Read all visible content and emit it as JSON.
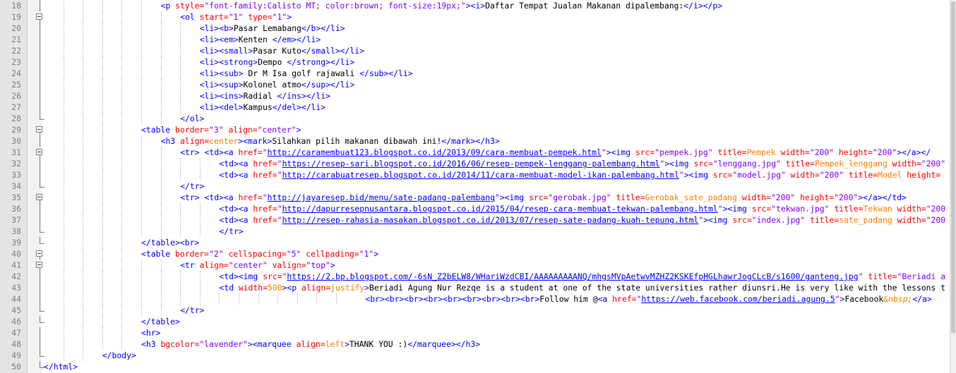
{
  "editor": {
    "lines": [
      {
        "n": "18",
        "indent": 6,
        "fold": "tick",
        "tokens": [
          [
            "tag",
            "<p "
          ],
          [
            "attr",
            "style="
          ],
          [
            "str",
            "\"font-family:Calisto MT; color:brown; font-size:19px;\""
          ],
          [
            "tag",
            ">"
          ],
          [
            "tag",
            "<i>"
          ],
          [
            "text",
            "Daftar Tempat Jualan Makanan dipalembang:"
          ],
          [
            "tag",
            "</i></p>"
          ]
        ]
      },
      {
        "n": "19",
        "indent": 7,
        "fold": "open",
        "tokens": [
          [
            "tag",
            "<ol "
          ],
          [
            "attr",
            "start="
          ],
          [
            "str",
            "\"1\" "
          ],
          [
            "attr",
            "type="
          ],
          [
            "str",
            "\"1\""
          ],
          [
            "tag",
            ">"
          ]
        ]
      },
      {
        "n": "20",
        "indent": 8,
        "fold": "tick",
        "tokens": [
          [
            "tag",
            "<li><b>"
          ],
          [
            "text",
            "Pasar Lemabang"
          ],
          [
            "tag",
            "</b></li>"
          ]
        ]
      },
      {
        "n": "21",
        "indent": 8,
        "fold": "tick",
        "tokens": [
          [
            "tag",
            "<li><em>"
          ],
          [
            "text",
            "Kenten "
          ],
          [
            "tag",
            "</em></li>"
          ]
        ]
      },
      {
        "n": "22",
        "indent": 8,
        "fold": "tick",
        "tokens": [
          [
            "tag",
            "<li><small>"
          ],
          [
            "text",
            "Pasar Kuto"
          ],
          [
            "tag",
            "</small></li>"
          ]
        ]
      },
      {
        "n": "23",
        "indent": 8,
        "fold": "tick",
        "tokens": [
          [
            "tag",
            "<li><strong>"
          ],
          [
            "text",
            "Dempo "
          ],
          [
            "tag",
            "</strong></li>"
          ]
        ]
      },
      {
        "n": "24",
        "indent": 8,
        "fold": "tick",
        "tokens": [
          [
            "tag",
            "<li><sub>"
          ],
          [
            "text",
            " Dr M Isa golf rajawali "
          ],
          [
            "tag",
            "</sub></li>"
          ]
        ]
      },
      {
        "n": "25",
        "indent": 8,
        "fold": "tick",
        "tokens": [
          [
            "tag",
            "<li><sup>"
          ],
          [
            "text",
            "Kolonel atmo"
          ],
          [
            "tag",
            "</sup></li>"
          ]
        ]
      },
      {
        "n": "26",
        "indent": 8,
        "fold": "tick",
        "tokens": [
          [
            "tag",
            "<li><ins>"
          ],
          [
            "text",
            "Radial "
          ],
          [
            "tag",
            "</ins></li>"
          ]
        ]
      },
      {
        "n": "27",
        "indent": 8,
        "fold": "tick",
        "tokens": [
          [
            "tag",
            "<li><del>"
          ],
          [
            "text",
            "Kampus"
          ],
          [
            "tag",
            "</del></li>"
          ]
        ]
      },
      {
        "n": "28",
        "indent": 7,
        "fold": "end",
        "tokens": [
          [
            "tag",
            "</ol>"
          ]
        ]
      },
      {
        "n": "29",
        "indent": 5,
        "fold": "open",
        "tokens": [
          [
            "tag",
            "<table "
          ],
          [
            "attr",
            "border="
          ],
          [
            "str",
            "\"3\" "
          ],
          [
            "attr",
            "align="
          ],
          [
            "str",
            "\"center\""
          ],
          [
            "tag",
            ">"
          ]
        ]
      },
      {
        "n": "30",
        "indent": 6,
        "fold": "tick",
        "tokens": [
          [
            "tag",
            "<h3 "
          ],
          [
            "attr",
            "align="
          ],
          [
            "unq",
            "center"
          ],
          [
            "tag",
            "><mark>"
          ],
          [
            "text",
            "Silahkan pilih makanan dibawah ini!"
          ],
          [
            "tag",
            "</mark></h3>"
          ]
        ]
      },
      {
        "n": "31",
        "indent": 7,
        "fold": "open",
        "tokens": [
          [
            "tag",
            "<tr> <td><a "
          ],
          [
            "attr",
            "href="
          ],
          [
            "str",
            "\""
          ],
          [
            "url",
            "http://caramembuat123.blogspot.co.id/2013/09/cara-membuat-pempek.html"
          ],
          [
            "str",
            "\""
          ],
          [
            "tag",
            "><img "
          ],
          [
            "attr",
            "src="
          ],
          [
            "str",
            "\"pempek.jpg\" "
          ],
          [
            "attr",
            "title="
          ],
          [
            "unq",
            "Pempek"
          ],
          [
            "attr",
            " width="
          ],
          [
            "str",
            "\"200\" "
          ],
          [
            "attr",
            "height="
          ],
          [
            "str",
            "\"200\""
          ],
          [
            "tag",
            "></a></"
          ]
        ]
      },
      {
        "n": "32",
        "indent": 9,
        "fold": "tick",
        "tokens": [
          [
            "tag",
            "<td><a "
          ],
          [
            "attr",
            "href="
          ],
          [
            "str",
            "\""
          ],
          [
            "url",
            "https://resep-sari.blogspot.co.id/2016/06/resep-pempek-lenggang-palembang.html"
          ],
          [
            "str",
            "\""
          ],
          [
            "tag",
            "><img "
          ],
          [
            "attr",
            "src="
          ],
          [
            "str",
            "\"lenggang.jpg\" "
          ],
          [
            "attr",
            "title="
          ],
          [
            "unq",
            "Pempek_lenggang"
          ],
          [
            "attr",
            " width="
          ],
          [
            "str",
            "\"200\""
          ]
        ]
      },
      {
        "n": "33",
        "indent": 9,
        "fold": "tick",
        "tokens": [
          [
            "tag",
            "<td><a "
          ],
          [
            "attr",
            "href="
          ],
          [
            "str",
            "\""
          ],
          [
            "url",
            "http://carabuatresep.blogspot.co.id/2014/11/cara-membuat-model-ikan-palembang.html"
          ],
          [
            "str",
            "\""
          ],
          [
            "tag",
            "><img "
          ],
          [
            "attr",
            "src="
          ],
          [
            "str",
            "\"model.jpg\" "
          ],
          [
            "attr",
            "width="
          ],
          [
            "str",
            "\"200\" "
          ],
          [
            "attr",
            "title="
          ],
          [
            "unq",
            "Model"
          ],
          [
            "attr",
            " height="
          ]
        ]
      },
      {
        "n": "34",
        "indent": 7,
        "fold": "end",
        "tokens": [
          [
            "tag",
            "</tr>"
          ]
        ]
      },
      {
        "n": "35",
        "indent": 7,
        "fold": "open",
        "tokens": [
          [
            "tag",
            "<tr> <td><a "
          ],
          [
            "attr",
            "href="
          ],
          [
            "str",
            "\""
          ],
          [
            "url",
            "http://jayaresep.bid/menu/sate-padang-palembang"
          ],
          [
            "str",
            "\""
          ],
          [
            "tag",
            "><img "
          ],
          [
            "attr",
            "src="
          ],
          [
            "str",
            "\"gerobak.jpg\" "
          ],
          [
            "attr",
            "title="
          ],
          [
            "unq",
            "Gerobak_sate_padang"
          ],
          [
            "attr",
            " width="
          ],
          [
            "str",
            "\"200\" "
          ],
          [
            "attr",
            "height="
          ],
          [
            "str",
            "\"200\""
          ],
          [
            "tag",
            "></a></td>"
          ]
        ]
      },
      {
        "n": "36",
        "indent": 9,
        "fold": "tick",
        "tokens": [
          [
            "tag",
            "<td><a "
          ],
          [
            "attr",
            "href="
          ],
          [
            "str",
            "\""
          ],
          [
            "url",
            "http://dapurresepnusantara.blogspot.co.id/2015/04/resep-cara-membuat-tekwan-palembang.html"
          ],
          [
            "str",
            "\""
          ],
          [
            "tag",
            "><img "
          ],
          [
            "attr",
            "src="
          ],
          [
            "str",
            "\"tekwan.jpg\" "
          ],
          [
            "attr",
            "title="
          ],
          [
            "unq",
            "Tekwan"
          ],
          [
            "attr",
            " width="
          ],
          [
            "str",
            "\"200"
          ]
        ]
      },
      {
        "n": "37",
        "indent": 9,
        "fold": "tick",
        "tokens": [
          [
            "tag",
            "<td><a "
          ],
          [
            "attr",
            "href="
          ],
          [
            "str",
            "\""
          ],
          [
            "url",
            "http://resep-rahasia-masakan.blogspot.co.id/2013/07/resep-sate-padang-kuah-tepung.html"
          ],
          [
            "str",
            "\""
          ],
          [
            "tag",
            "><img "
          ],
          [
            "attr",
            "src="
          ],
          [
            "str",
            "\"index.jpg\" "
          ],
          [
            "attr",
            "title="
          ],
          [
            "unq",
            "sate_padang"
          ],
          [
            "attr",
            " width="
          ],
          [
            "str",
            "\"200"
          ]
        ]
      },
      {
        "n": "38",
        "indent": 9,
        "fold": "end",
        "tokens": [
          [
            "tag",
            "</tr>"
          ]
        ]
      },
      {
        "n": "39",
        "indent": 5,
        "fold": "end",
        "tokens": [
          [
            "tag",
            "</table><br>"
          ]
        ]
      },
      {
        "n": "40",
        "indent": 5,
        "fold": "open",
        "tokens": [
          [
            "tag",
            "<table "
          ],
          [
            "attr",
            "border="
          ],
          [
            "str",
            "\"2\" "
          ],
          [
            "attr",
            "cellspacing="
          ],
          [
            "str",
            "\"5\" "
          ],
          [
            "attr",
            "cellpading="
          ],
          [
            "str",
            "\"1\""
          ],
          [
            "tag",
            ">"
          ]
        ]
      },
      {
        "n": "41",
        "indent": 7,
        "fold": "open",
        "tokens": [
          [
            "tag",
            "<tr "
          ],
          [
            "attr",
            "align="
          ],
          [
            "str",
            "\"center\" "
          ],
          [
            "attr",
            "valign="
          ],
          [
            "str",
            "\"top\""
          ],
          [
            "tag",
            ">"
          ]
        ]
      },
      {
        "n": "42",
        "indent": 9,
        "fold": "tick",
        "tokens": [
          [
            "tag",
            "<td><img "
          ],
          [
            "attr",
            "src="
          ],
          [
            "str",
            "\""
          ],
          [
            "url",
            "https://2.bp.blogspot.com/-6sN_Z2bELW8/WHariWzdCBI/AAAAAAAAANQ/mhgsMVpAetwvMZHZ2KSKEfpHGLhawrJogCLcB/s1600/ganteng.jpg"
          ],
          [
            "str",
            "\" "
          ],
          [
            "attr",
            "title="
          ],
          [
            "str",
            "\"Beriadi a"
          ]
        ]
      },
      {
        "n": "43",
        "indent": 9,
        "fold": "tick",
        "tokens": [
          [
            "tag",
            "<td "
          ],
          [
            "attr",
            "width="
          ],
          [
            "unq",
            "500"
          ],
          [
            "tag",
            "><p "
          ],
          [
            "attr",
            "align="
          ],
          [
            "unq",
            "justify"
          ],
          [
            "tag",
            ">"
          ],
          [
            "text",
            "Beriadi Agung Nur Rezqe is a student at one of the state universities rather diunsri.He is very like with the lessons t"
          ]
        ]
      },
      {
        "n": "44",
        "indent": 0,
        "pad": 66,
        "fold": "tick",
        "tokens": [
          [
            "tag",
            "<br><br><br><br><br><br><br><br><br>"
          ],
          [
            "text",
            "Follow him @"
          ],
          [
            "tag",
            "<a "
          ],
          [
            "attr",
            "href="
          ],
          [
            "str",
            "\""
          ],
          [
            "url",
            "https://web.facebook.com/beriadi.agung.5"
          ],
          [
            "str",
            "\""
          ],
          [
            "tag",
            ">"
          ],
          [
            "text",
            "Facebook"
          ],
          [
            "ent",
            "&nbsp;"
          ],
          [
            "tag",
            "</a>"
          ]
        ]
      },
      {
        "n": "45",
        "indent": 7,
        "fold": "end",
        "tokens": [
          [
            "tag",
            "</tr>"
          ]
        ]
      },
      {
        "n": "46",
        "indent": 5,
        "fold": "end",
        "tokens": [
          [
            "tag",
            "</table>"
          ]
        ]
      },
      {
        "n": "47",
        "indent": 5,
        "fold": "tick",
        "tokens": [
          [
            "tag",
            "<hr>"
          ]
        ]
      },
      {
        "n": "48",
        "indent": 5,
        "fold": "tick",
        "tokens": [
          [
            "tag",
            "<h3 "
          ],
          [
            "attr",
            "bgcolor="
          ],
          [
            "str",
            "\"lavender\""
          ],
          [
            "tag",
            "><marquee "
          ],
          [
            "attr",
            "align="
          ],
          [
            "unq",
            "left"
          ],
          [
            "tag",
            ">"
          ],
          [
            "text",
            "THANK YOU :)"
          ],
          [
            "tag",
            "</marquee></h3>"
          ]
        ]
      },
      {
        "n": "49",
        "indent": 3,
        "fold": "end",
        "tokens": [
          [
            "tag",
            "</body>"
          ]
        ]
      },
      {
        "n": "50",
        "indent": 0,
        "fold": "end",
        "tokens": [
          [
            "tag",
            "</html>"
          ]
        ]
      }
    ]
  },
  "colors": {
    "tag": "#0000ff",
    "attr": "#ff0000",
    "str": "#8000ff",
    "text": "#000000",
    "entity": "#ff8000",
    "line_number": "#808080",
    "gutter": "#e4e4e4"
  }
}
